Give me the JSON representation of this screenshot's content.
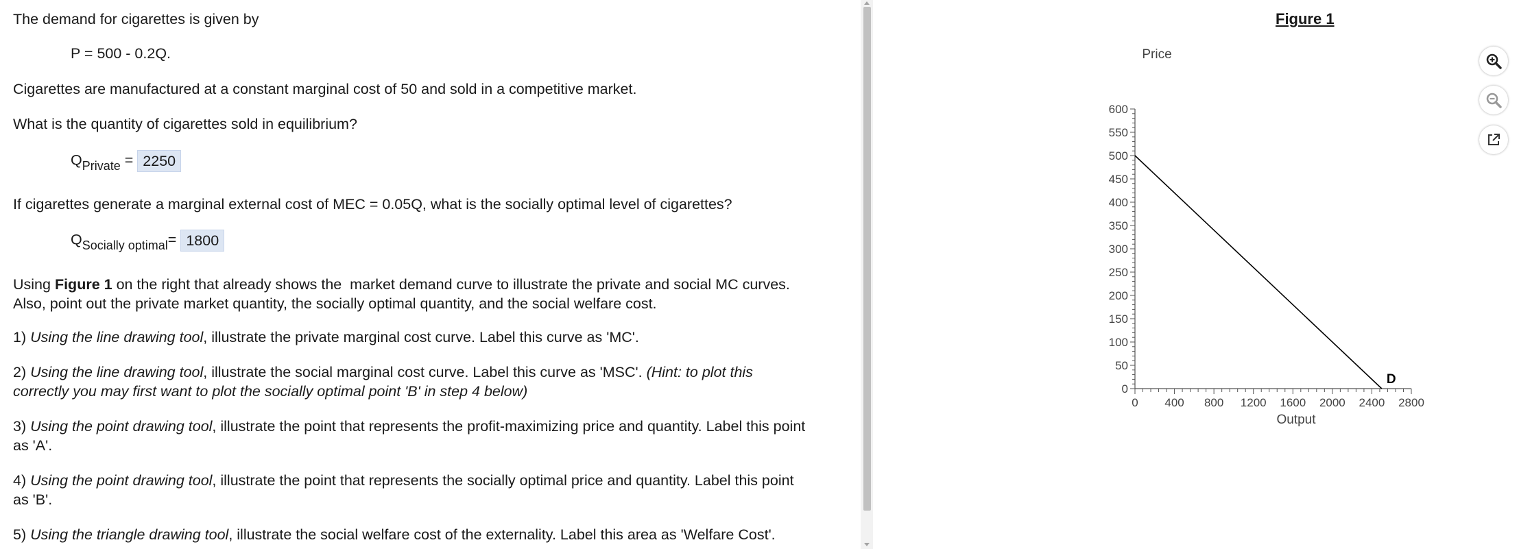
{
  "question": {
    "intro": "The demand for cigarettes is given by",
    "equation": "P = 500 - 0.2Q.",
    "cost_statement": "Cigarettes are manufactured at a constant marginal cost of 50 and sold in a competitive market.",
    "q1": "What is the quantity of cigarettes sold in equilibrium?",
    "q_private_main": "Q",
    "q_private_sub": "Private",
    "q_private_eq": " = ",
    "q_private_value": "2250",
    "q2": "If cigarettes generate a marginal external cost of MEC = 0.05Q, what is the socially optimal level of cigarettes?",
    "q_social_main": "Q",
    "q_social_sub": "Socially optimal",
    "q_social_eq": "= ",
    "q_social_value": "1800",
    "instr_a": "Using ",
    "instr_b": "Figure 1",
    "instr_c": " on the right that already shows the  market demand curve to illustrate the private and social MC curves.",
    "instr_line2": "Also, point out the private market quantity, the socially optimal quantity, and the social welfare cost.",
    "step1_num": "1) ",
    "step1_tool": "Using the line drawing tool",
    "step1_rest": ", illustrate the private marginal cost curve. Label this curve as 'MC'.",
    "step2_num": "2) ",
    "step2_tool": "Using the line drawing tool",
    "step2_rest": ", illustrate the social marginal cost curve. Label this curve as 'MSC'. ",
    "step2_hint1": "(Hint: to plot this",
    "step2_hint2": "correctly you may first want to plot the socially optimal point 'B' in step 4 below)",
    "step3_num": "3) ",
    "step3_tool": "Using the point drawing tool",
    "step3_rest": ", illustrate the point that represents the profit-maximizing price and quantity. Label this point",
    "step3_line2": "as 'A'.",
    "step4_num": "4) ",
    "step4_tool": "Using the point drawing tool",
    "step4_rest": ", illustrate the point that represents the socially optimal price and quantity. Label this point",
    "step4_line2": "as 'B'.",
    "step5_num": "5) ",
    "step5_tool": "Using the triangle drawing tool",
    "step5_rest": ", illustrate the social welfare cost of the externality. Label this area as 'Welfare Cost'."
  },
  "figure": {
    "title": "Figure 1",
    "tools": {
      "zoom_in": "zoom-in-icon",
      "zoom_out": "zoom-out-icon",
      "popout": "external-link-icon"
    }
  },
  "chart_data": {
    "type": "line",
    "title": "",
    "xlabel": "Output",
    "ylabel": "Price",
    "xlim": [
      0,
      2800
    ],
    "ylim": [
      0,
      600
    ],
    "x_ticks": [
      "0",
      "400",
      "800",
      "1200",
      "1600",
      "2000",
      "2400",
      "2800"
    ],
    "y_ticks": [
      "0",
      "50",
      "100",
      "150",
      "200",
      "250",
      "300",
      "350",
      "400",
      "450",
      "500",
      "550",
      "600"
    ],
    "series": [
      {
        "name": "D",
        "x": [
          0,
          2500
        ],
        "y": [
          500,
          0
        ]
      }
    ],
    "colors": {
      "line": "#000000",
      "axis": "#555555"
    }
  }
}
